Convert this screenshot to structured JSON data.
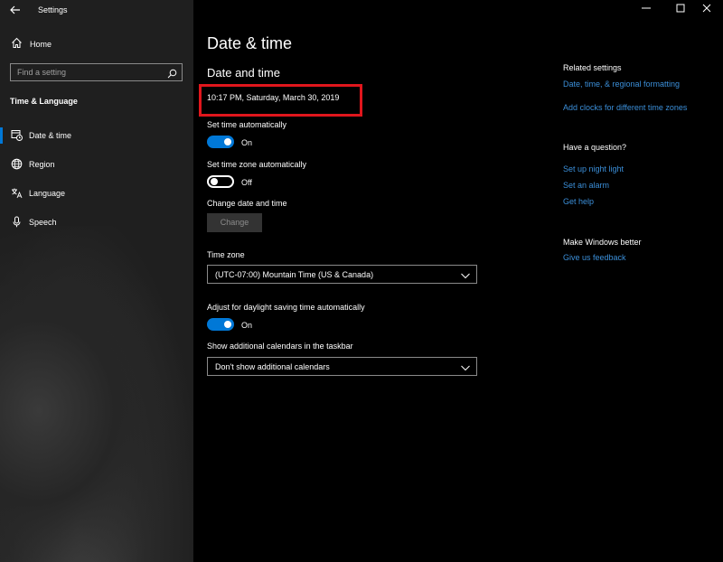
{
  "window": {
    "title": "Settings",
    "controls": {
      "minimize": "—",
      "maximize": "☐",
      "close": "✕"
    }
  },
  "sidebar": {
    "home_label": "Home",
    "search_placeholder": "Find a setting",
    "section_title": "Time & Language",
    "items": [
      {
        "label": "Date & time",
        "icon": "calendar-clock-icon",
        "active": true
      },
      {
        "label": "Region",
        "icon": "globe-icon",
        "active": false
      },
      {
        "label": "Language",
        "icon": "language-icon",
        "active": false
      },
      {
        "label": "Speech",
        "icon": "microphone-icon",
        "active": false
      }
    ]
  },
  "main": {
    "page_title": "Date & time",
    "section_title": "Date and time",
    "current_datetime": "10:17 PM, Saturday, March 30, 2019",
    "set_time_auto": {
      "label": "Set time automatically",
      "state": "On"
    },
    "set_timezone_auto": {
      "label": "Set time zone automatically",
      "state": "Off"
    },
    "change_date_time": {
      "label": "Change date and time",
      "button": "Change"
    },
    "time_zone": {
      "label": "Time zone",
      "value": "(UTC-07:00) Mountain Time (US & Canada)"
    },
    "daylight_saving": {
      "label": "Adjust for daylight saving time automatically",
      "state": "On"
    },
    "additional_calendars": {
      "label": "Show additional calendars in the taskbar",
      "value": "Don't show additional calendars"
    }
  },
  "right": {
    "related_title": "Related settings",
    "related_links": [
      "Date, time, & regional formatting",
      "Add clocks for different time zones"
    ],
    "question_title": "Have a question?",
    "question_links": [
      "Set up night light",
      "Set an alarm",
      "Get help"
    ],
    "better_title": "Make Windows better",
    "better_links": [
      "Give us feedback"
    ]
  },
  "colors": {
    "accent": "#0078d7",
    "link": "#3b8fd9",
    "highlight_box": "#e0161c",
    "sidebar_bg": "#1f1f1f",
    "main_bg": "#000000"
  }
}
